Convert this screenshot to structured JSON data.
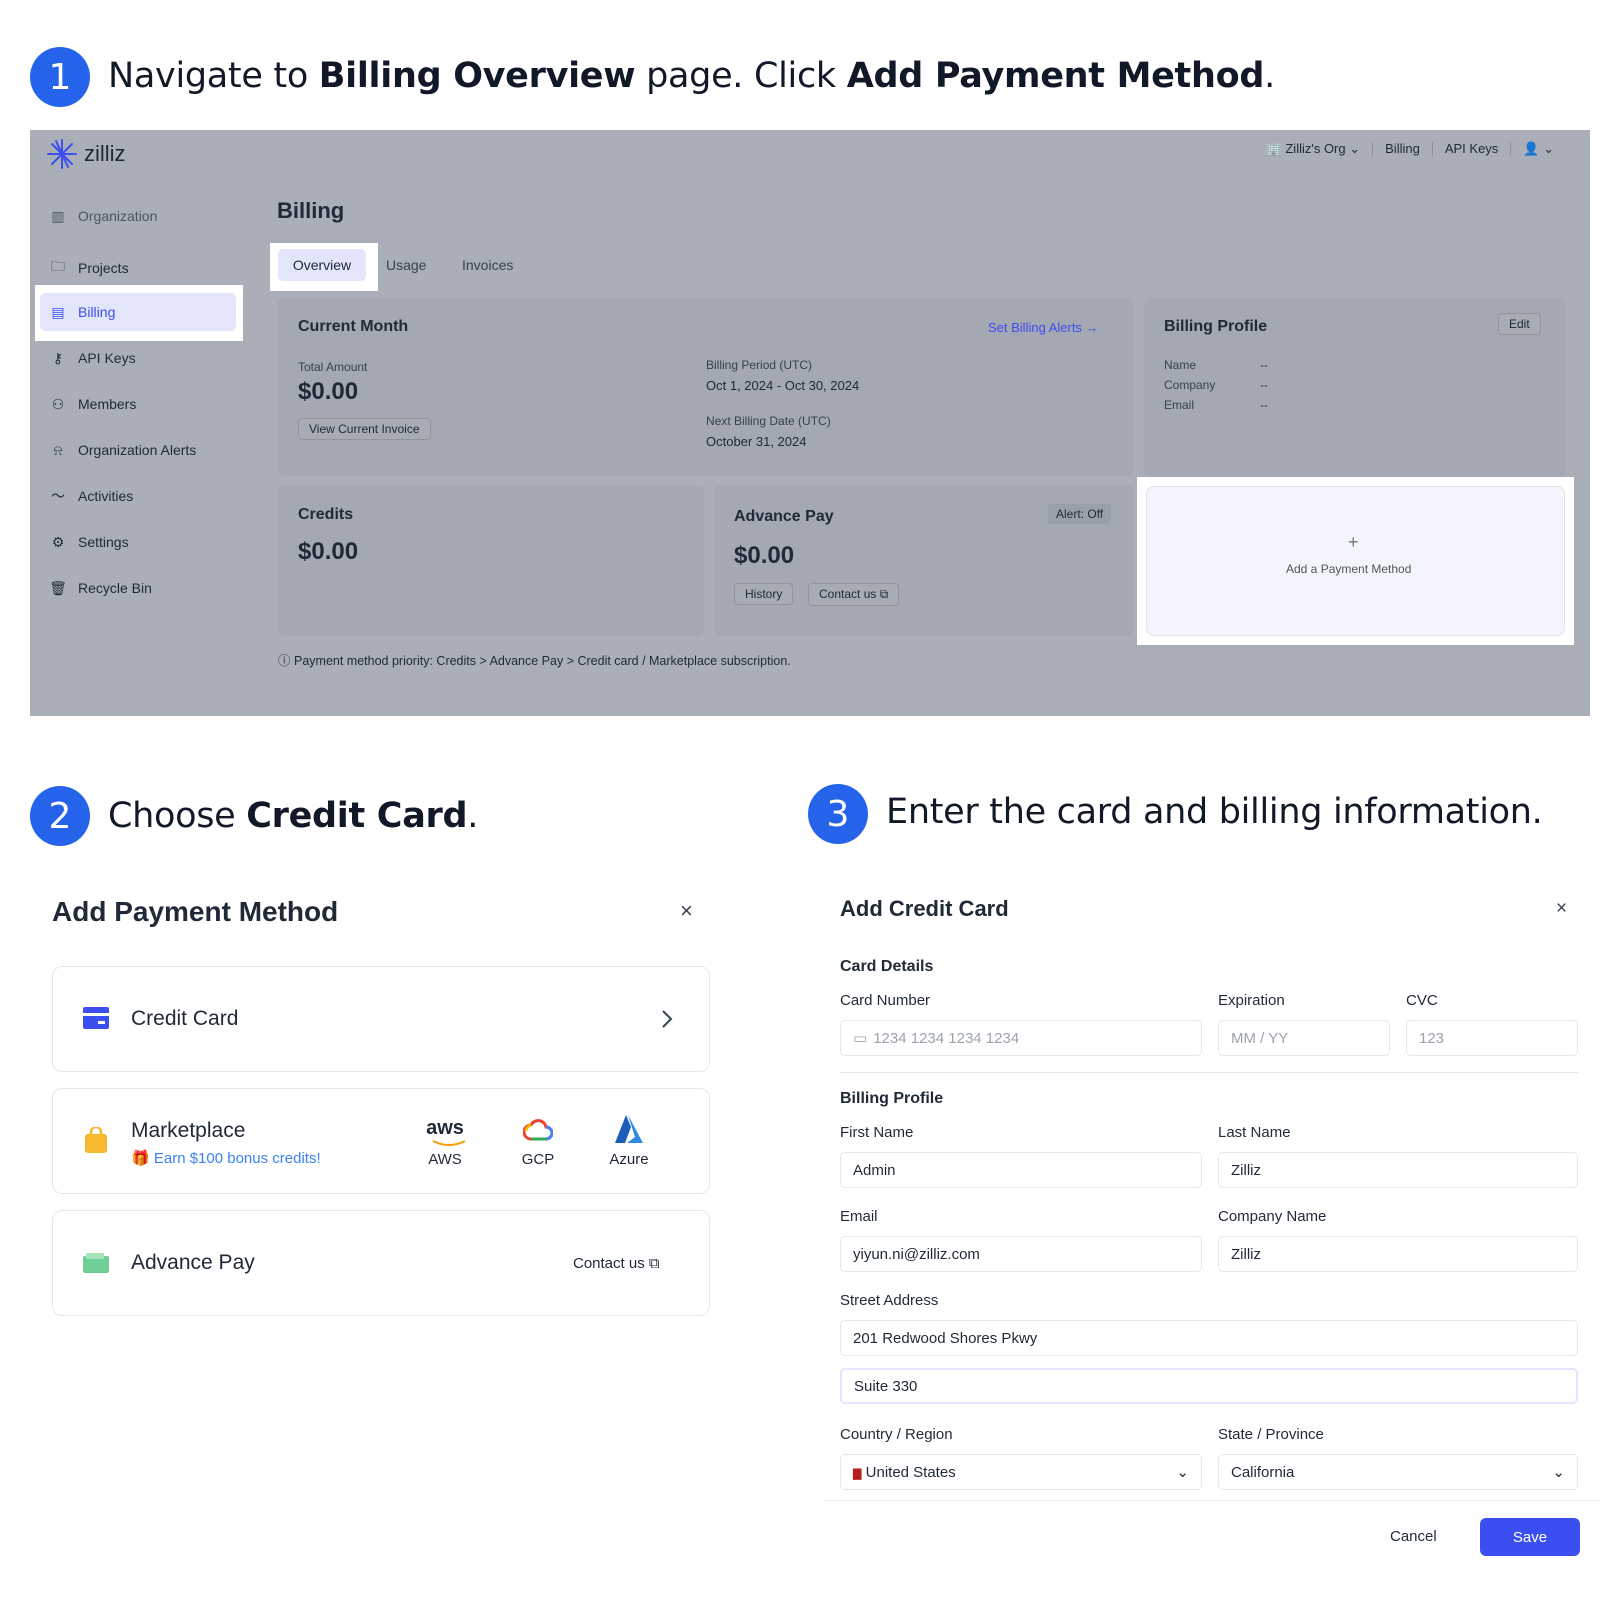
{
  "steps": [
    {
      "num": "1",
      "pre": "Navigate to ",
      "b1": "Billing Overview",
      "mid": " page. Click ",
      "b2": "Add Payment Method",
      "post": "."
    },
    {
      "num": "2",
      "pre": "Choose ",
      "b1": "Credit Card",
      "post": "."
    },
    {
      "num": "3",
      "text": "Enter the card and billing information."
    }
  ],
  "app": {
    "logo": "zilliz",
    "topnav": {
      "org": "Zilliz's Org",
      "billing": "Billing",
      "api_keys": "API Keys"
    },
    "sidebar": [
      "Organization",
      "Projects",
      "Billing",
      "API Keys",
      "Members",
      "Organization Alerts",
      "Activities",
      "Settings",
      "Recycle Bin"
    ],
    "page_title": "Billing",
    "tabs": [
      "Overview",
      "Usage",
      "Invoices"
    ],
    "current_month": {
      "title": "Current Month",
      "alerts_link": "Set Billing Alerts →",
      "total_label": "Total Amount",
      "total_value": "$0.00",
      "view_invoice": "View Current Invoice",
      "period_label": "Billing Period (UTC)",
      "period_value": "Oct 1, 2024 - Oct 30, 2024",
      "next_label": "Next Billing Date (UTC)",
      "next_value": "October 31, 2024"
    },
    "billing_profile": {
      "title": "Billing Profile",
      "edit": "Edit",
      "rows": [
        {
          "k": "Name",
          "v": "--"
        },
        {
          "k": "Company",
          "v": "--"
        },
        {
          "k": "Email",
          "v": "--"
        }
      ]
    },
    "credits": {
      "title": "Credits",
      "value": "$0.00"
    },
    "advance_pay": {
      "title": "Advance Pay",
      "alert": "Alert: Off",
      "value": "$0.00",
      "history": "History",
      "contact": "Contact us"
    },
    "add_payment": {
      "plus": "+",
      "label": "Add a Payment Method"
    },
    "priority_note": "Payment method priority: Credits > Advance Pay > Credit card / Marketplace subscription."
  },
  "add_payment_dialog": {
    "title": "Add Payment Method",
    "close": "×",
    "credit_card": "Credit Card",
    "marketplace": "Marketplace",
    "bonus": "Earn $100 bonus credits!",
    "providers": [
      {
        "logo": "aws",
        "name": "AWS"
      },
      {
        "name": "GCP"
      },
      {
        "name": "Azure"
      }
    ],
    "advance_pay": "Advance Pay",
    "contact": "Contact us"
  },
  "credit_card_dialog": {
    "title": "Add Credit Card",
    "close": "×",
    "card_details": "Card Details",
    "card_number_label": "Card Number",
    "card_number_placeholder": "1234 1234 1234 1234",
    "expiration_label": "Expiration",
    "expiration_placeholder": "MM / YY",
    "cvc_label": "CVC",
    "cvc_placeholder": "123",
    "billing_profile": "Billing Profile",
    "first_name_label": "First Name",
    "first_name": "Admin",
    "last_name_label": "Last Name",
    "last_name": "Zilliz",
    "email_label": "Email",
    "email": "yiyun.ni@zilliz.com",
    "company_label": "Company Name",
    "company": "Zilliz",
    "street_label": "Street Address",
    "street1": "201 Redwood Shores Pkwy",
    "street2": "Suite 330",
    "country_label": "Country / Region",
    "country": "United States",
    "state_label": "State / Province",
    "state": "California",
    "cancel": "Cancel",
    "save": "Save"
  },
  "colors": {
    "primary": "#2563eb",
    "save": "#3b4ef0",
    "link": "#4f5ee6",
    "overlay": "#a9aeb8"
  }
}
